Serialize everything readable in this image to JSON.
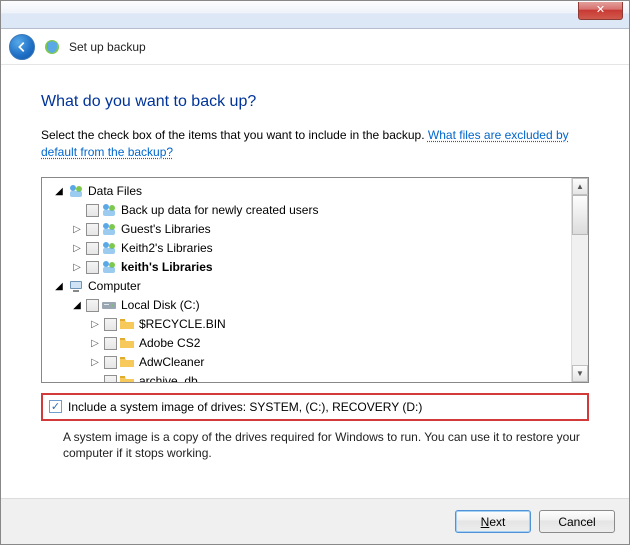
{
  "window": {
    "close_glyph": "✕"
  },
  "header": {
    "title": "Set up backup"
  },
  "main": {
    "heading": "What do you want to back up?",
    "instruction_pre": "Select the check box of the items that you want to include in the backup. ",
    "instruction_link": "What files are excluded by default from the backup?"
  },
  "tree": [
    {
      "indent": 0,
      "expander": "open",
      "checkbox": false,
      "icon": "people",
      "label": "Data Files",
      "bold": false
    },
    {
      "indent": 1,
      "expander": "none",
      "checkbox": true,
      "icon": "people",
      "label": "Back up data for newly created users",
      "bold": false
    },
    {
      "indent": 1,
      "expander": "closed",
      "checkbox": true,
      "icon": "people",
      "label": "Guest's Libraries",
      "bold": false
    },
    {
      "indent": 1,
      "expander": "closed",
      "checkbox": true,
      "icon": "people",
      "label": "Keith2's Libraries",
      "bold": false
    },
    {
      "indent": 1,
      "expander": "closed",
      "checkbox": true,
      "icon": "people",
      "label": "keith's Libraries",
      "bold": true
    },
    {
      "indent": 0,
      "expander": "open",
      "checkbox": false,
      "icon": "computer",
      "label": "Computer",
      "bold": false
    },
    {
      "indent": 1,
      "expander": "open",
      "checkbox": true,
      "icon": "drive",
      "label": "Local Disk (C:)",
      "bold": false
    },
    {
      "indent": 2,
      "expander": "closed",
      "checkbox": true,
      "icon": "folder",
      "label": "$RECYCLE.BIN",
      "bold": false
    },
    {
      "indent": 2,
      "expander": "closed",
      "checkbox": true,
      "icon": "folder",
      "label": "Adobe CS2",
      "bold": false
    },
    {
      "indent": 2,
      "expander": "closed",
      "checkbox": true,
      "icon": "folder",
      "label": "AdwCleaner",
      "bold": false
    },
    {
      "indent": 2,
      "expander": "none",
      "checkbox": true,
      "icon": "folder",
      "label": "archive_db",
      "bold": false
    }
  ],
  "system_image": {
    "checked": true,
    "label": "Include a system image of drives: SYSTEM, (C:), RECOVERY (D:)",
    "description": "A system image is a copy of the drives required for Windows to run. You can use it to restore your computer if it stops working."
  },
  "footer": {
    "next": "Next",
    "cancel": "Cancel"
  },
  "icons": {
    "people_colors": [
      "#5aa9e6",
      "#7ec850"
    ],
    "computer_color": "#6c93b8",
    "drive_color": "#9aa7b3",
    "folder_color": "#f6c95a"
  }
}
